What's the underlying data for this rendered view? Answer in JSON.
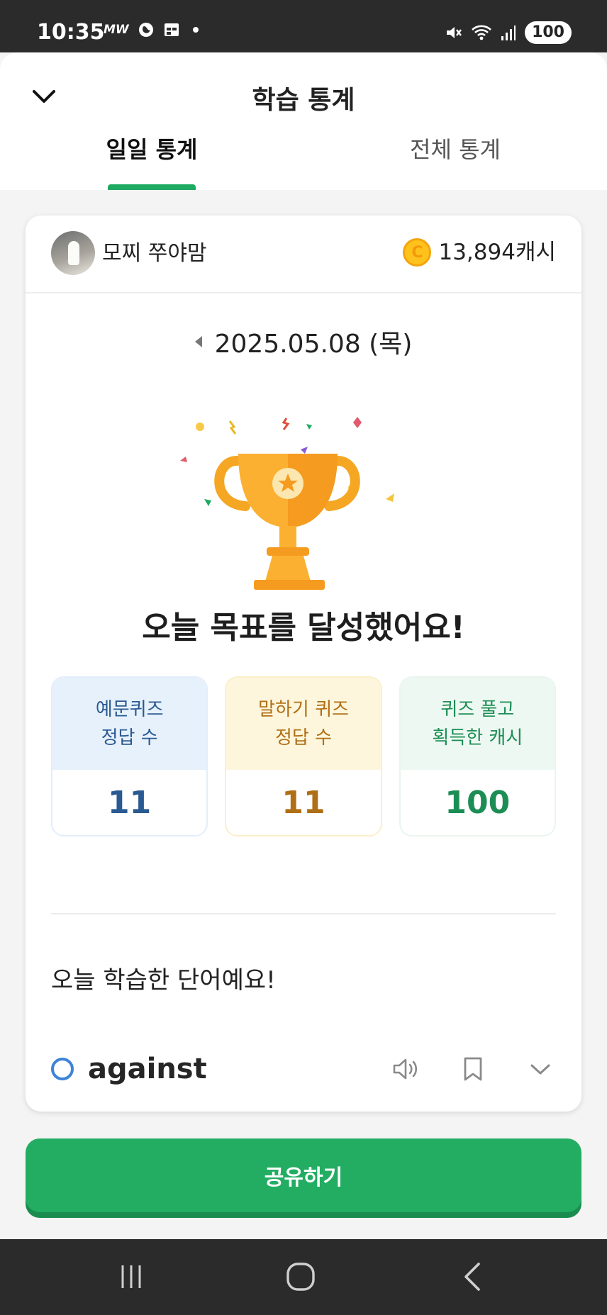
{
  "status_bar": {
    "time": "10:35",
    "carrier_badge": "MW",
    "battery": "100",
    "icons": [
      "meta-icon",
      "calendar-icon",
      "dot-icon",
      "mute-icon",
      "wifi-icon",
      "signal-icon"
    ]
  },
  "header": {
    "title": "학습 통계",
    "close_icon": "chevron-down-icon",
    "tabs": [
      {
        "label": "일일 통계",
        "active": true
      },
      {
        "label": "전체 통계",
        "active": false
      }
    ],
    "accent_color": "#1faa62"
  },
  "profile": {
    "name": "모찌 쭈야맘",
    "cash": "13,894캐시",
    "coin_icon": "coin-icon"
  },
  "date": {
    "value": "2025.05.08 (목)",
    "prev_icon": "triangle-left-icon"
  },
  "achievement": {
    "icon": "trophy-icon",
    "message": "오늘 목표를 달성했어요!"
  },
  "stats": [
    {
      "label": "예문퀴즈\n정답 수",
      "value": "11",
      "color": "#2a5a92"
    },
    {
      "label": "말하기 퀴즈\n정답 수",
      "value": "11",
      "color": "#b06f14"
    },
    {
      "label": "퀴즈 풀고\n획득한 캐시",
      "value": "100",
      "color": "#1c8e55"
    }
  ],
  "words_section": {
    "title": "오늘 학습한 단어예요!",
    "items": [
      {
        "word": "against",
        "status_icon": "circle-icon",
        "actions": [
          "speaker-icon",
          "bookmark-icon",
          "chevron-down-icon"
        ]
      }
    ]
  },
  "share_button": {
    "label": "공유하기",
    "color": "#22ad63"
  },
  "nav_bar": {
    "buttons": [
      "recent-apps-icon",
      "home-icon",
      "back-icon"
    ]
  }
}
